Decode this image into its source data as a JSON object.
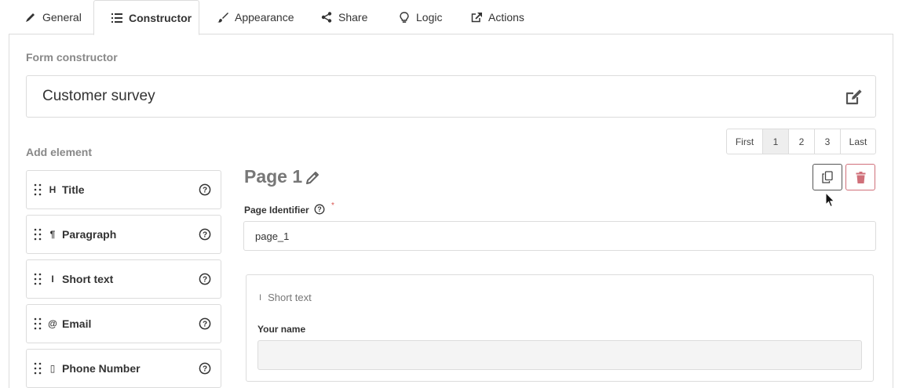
{
  "tabs": [
    {
      "label": "General",
      "icon": "pencil-icon"
    },
    {
      "label": "Constructor",
      "icon": "list-icon"
    },
    {
      "label": "Appearance",
      "icon": "brush-icon"
    },
    {
      "label": "Share",
      "icon": "share-icon"
    },
    {
      "label": "Logic",
      "icon": "lightbulb-icon"
    },
    {
      "label": "Actions",
      "icon": "external-link-icon"
    }
  ],
  "active_tab": "Constructor",
  "constructor": {
    "section_label": "Form constructor",
    "form_title": "Customer survey",
    "add_element_label": "Add element"
  },
  "pagination": {
    "first": "First",
    "pages": [
      "1",
      "2",
      "3"
    ],
    "active_page": "1",
    "last": "Last"
  },
  "elements": [
    {
      "label": "Title",
      "icon": "H"
    },
    {
      "label": "Paragraph",
      "icon": "¶"
    },
    {
      "label": "Short text",
      "icon": "I"
    },
    {
      "label": "Email",
      "icon": "@"
    },
    {
      "label": "Phone Number",
      "icon": "▯"
    }
  ],
  "page": {
    "title": "Page 1",
    "identifier_label": "Page Identifier",
    "required_mark": "*",
    "identifier_value": "page_1"
  },
  "card": {
    "type_label": "Short text",
    "type_icon": "I",
    "field_label": "Your name",
    "field_value": ""
  },
  "colors": {
    "border": "#dcdcdc",
    "delete": "#d0707a",
    "required": "#d9534f",
    "muted": "#888888"
  }
}
